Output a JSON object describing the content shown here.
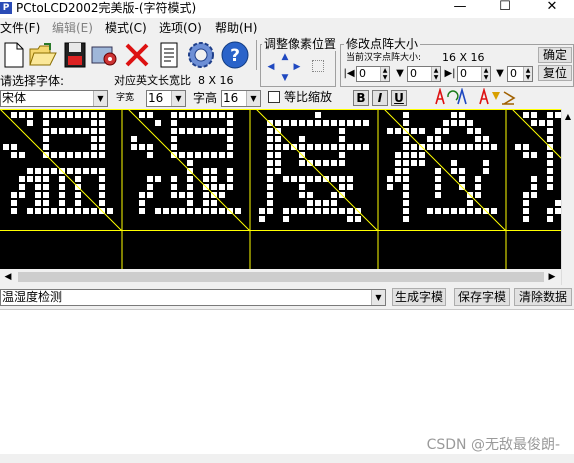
{
  "window": {
    "title": "PCtoLCD2002完美版-(字符模式)",
    "icon_label": "P"
  },
  "menu": [
    {
      "label": "文件(F)",
      "enabled": true
    },
    {
      "label": "编辑(E)",
      "enabled": false
    },
    {
      "label": "模式(C)",
      "enabled": true
    },
    {
      "label": "选项(O)",
      "enabled": true
    },
    {
      "label": "帮助(H)",
      "enabled": true
    }
  ],
  "toolbar": {
    "icons": [
      "new-file-icon",
      "open-folder-icon",
      "save-icon",
      "settings-gear-icon",
      "delete-x-icon",
      "document-icon",
      "options-gear-icon",
      "help-icon"
    ]
  },
  "pixel_adjust": {
    "title": "调整像素位置"
  },
  "matrix_size": {
    "title": "修改点阵大小",
    "current_label": "当前汉字点阵大小:",
    "current_value": "16 X 16",
    "confirm_label": "确定",
    "reset_label": "复位",
    "spinners": [
      "0",
      "0",
      "0",
      "0"
    ]
  },
  "font_select": {
    "label": "请选择字体:",
    "value": "宋体",
    "ratio_label": "对应英文长宽比",
    "ratio_value": "8 X 16",
    "width_label": "字宽",
    "width_value": "16",
    "height_label": "字高",
    "height_value": "16",
    "proportional_label": "等比缩放",
    "proportional_checked": false,
    "bold_label": "B",
    "italic_label": "I",
    "underline_label": "U"
  },
  "preview": {
    "characters": [
      "温",
      "湿",
      "度",
      "检",
      "测"
    ],
    "pixel_color": "#ffffff",
    "grid_color": "#ffff00",
    "background": "#000000"
  },
  "input": {
    "text": "温湿度检测",
    "generate_label": "生成字模",
    "save_label": "保存字模",
    "clear_label": "清除数据"
  },
  "watermark": "CSDN @无敌最俊朗-"
}
